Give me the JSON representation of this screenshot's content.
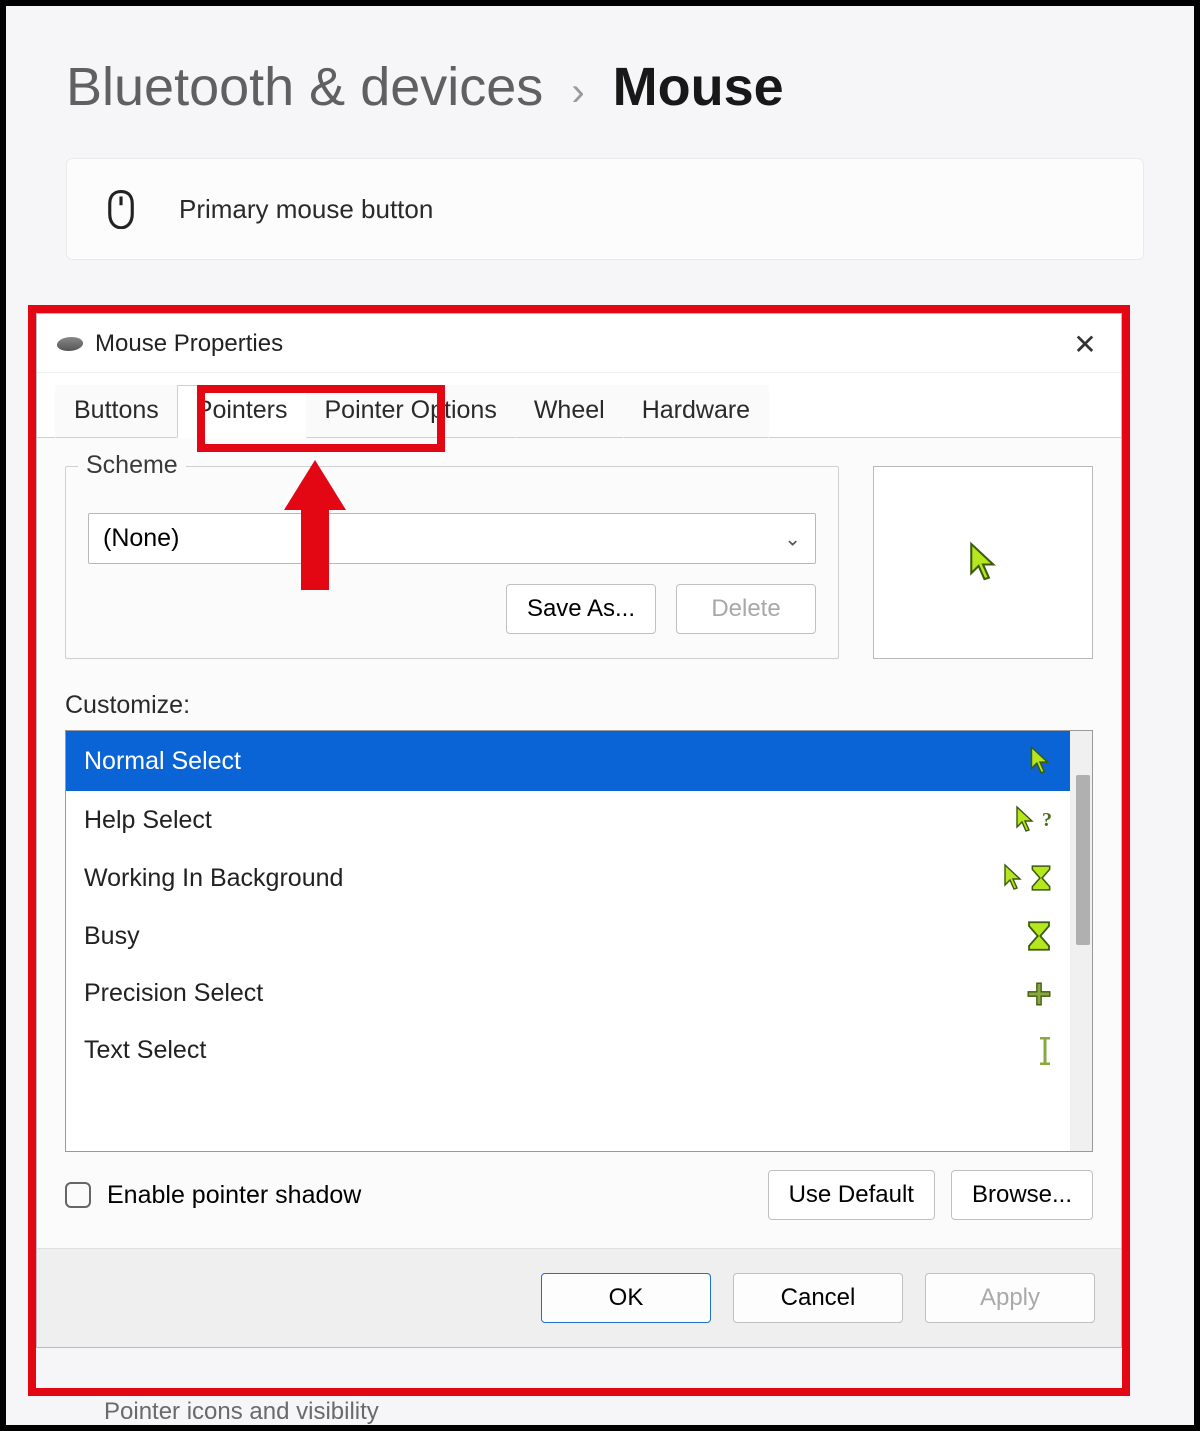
{
  "breadcrumb": {
    "parent": "Bluetooth & devices",
    "current": "Mouse"
  },
  "settings_row1": "Primary mouse button",
  "settings_row_below": "Pointer icons and visibility",
  "dialog": {
    "title": "Mouse Properties",
    "tabs": [
      "Buttons",
      "Pointers",
      "Pointer Options",
      "Wheel",
      "Hardware"
    ],
    "scheme_legend": "Scheme",
    "scheme_value": "(None)",
    "save_as": "Save As...",
    "delete": "Delete",
    "customize_label": "Customize:",
    "list": [
      {
        "label": "Normal Select",
        "icon": "arrow"
      },
      {
        "label": "Help Select",
        "icon": "arrow-help"
      },
      {
        "label": "Working In Background",
        "icon": "arrow-hourglass"
      },
      {
        "label": "Busy",
        "icon": "hourglass"
      },
      {
        "label": "Precision Select",
        "icon": "cross"
      },
      {
        "label": "Text Select",
        "icon": "ibeam"
      }
    ],
    "shadow_label": "Enable pointer shadow",
    "use_default": "Use Default",
    "browse": "Browse...",
    "ok": "OK",
    "cancel": "Cancel",
    "apply": "Apply"
  },
  "colors": {
    "highlight": "#e30613",
    "selection": "#0a64d6",
    "cursor": "#b6e61d",
    "cursor_stroke": "#3a5a0c"
  }
}
